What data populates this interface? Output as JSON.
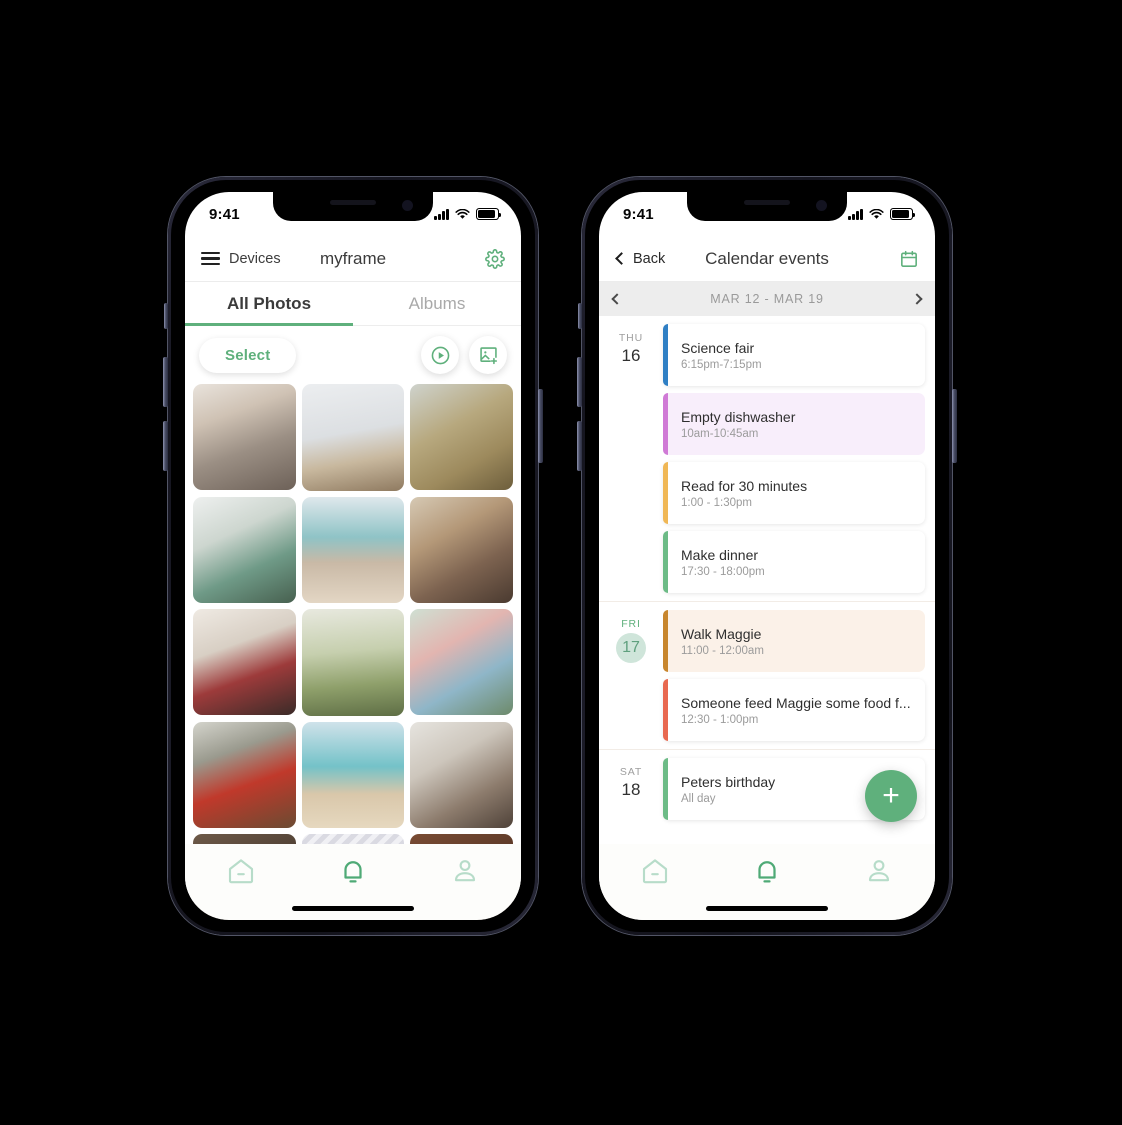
{
  "theme": {
    "accent_green": "#5fb07c",
    "accent_green_light": "#b7dcc9",
    "text_dark": "#3b3b3b",
    "text_muted": "#9a9a9a"
  },
  "phone_left": {
    "status_bar": {
      "time": "9:41",
      "signal_icon": "cellular-signal-icon",
      "wifi_icon": "wifi-icon",
      "battery_icon": "battery-icon"
    },
    "app_bar": {
      "menu_icon": "hamburger-menu-icon",
      "devices_label": "Devices",
      "title": "myframe",
      "settings_icon": "gear-icon"
    },
    "tabs": [
      {
        "label": "All Photos",
        "active": true
      },
      {
        "label": "Albums",
        "active": false
      }
    ],
    "actions": {
      "select_label": "Select",
      "play_icon": "play-circle-icon",
      "add_photo_icon": "add-image-icon"
    },
    "photos": [
      {
        "name": "grandparents-with-laptop"
      },
      {
        "name": "family-walking-in-snow"
      },
      {
        "name": "father-swinging-toddler"
      },
      {
        "name": "family-unpacking-boxes-living-room"
      },
      {
        "name": "mother-and-children-at-beach"
      },
      {
        "name": "family-of-three-on-couch"
      },
      {
        "name": "graduation-group-photo"
      },
      {
        "name": "family-on-park-path"
      },
      {
        "name": "family-with-bike-helmet-outdoors"
      },
      {
        "name": "father-teaching-child-to-ride-bike"
      },
      {
        "name": "couple-with-baby-on-beach"
      },
      {
        "name": "family-lying-together-smiling"
      },
      {
        "name": "partial-photo-bottom-left"
      },
      {
        "name": "partial-photo-bottom-center"
      },
      {
        "name": "partial-photo-bottom-right"
      }
    ],
    "bottom_nav": [
      {
        "icon": "home-icon",
        "active": false
      },
      {
        "icon": "bell-icon",
        "active": true
      },
      {
        "icon": "person-icon",
        "active": false
      }
    ]
  },
  "phone_right": {
    "status_bar": {
      "time": "9:41",
      "signal_icon": "cellular-signal-icon",
      "wifi_icon": "wifi-icon",
      "battery_icon": "battery-icon"
    },
    "app_bar": {
      "back_label": "Back",
      "back_icon": "chevron-left-icon",
      "title": "Calendar events",
      "calendar_icon": "calendar-icon"
    },
    "week_nav": {
      "prev_icon": "chevron-left-icon",
      "range_label": "MAR 12 - MAR 19",
      "next_icon": "chevron-right-icon"
    },
    "days": [
      {
        "dow": "THU",
        "date": "16",
        "highlighted": false,
        "events": [
          {
            "title": "Science fair",
            "time": "6:15pm-7:15pm",
            "bar_color": "#2f7fc4",
            "bg": "#ffffff"
          },
          {
            "title": "Empty dishwasher",
            "time": "10am-10:45am",
            "bar_color": "#d07ad6",
            "bg": "#f8eefb"
          },
          {
            "title": "Read for 30 minutes",
            "time": "1:00 - 1:30pm",
            "bar_color": "#f0b755",
            "bg": "#ffffff"
          },
          {
            "title": "Make dinner",
            "time": "17:30 - 18:00pm",
            "bar_color": "#6cbb86",
            "bg": "#ffffff"
          }
        ]
      },
      {
        "dow": "FRI",
        "date": "17",
        "highlighted": true,
        "events": [
          {
            "title": "Walk Maggie",
            "time": "11:00 - 12:00am",
            "bar_color": "#c8862d",
            "bg": "#fbf1e8"
          },
          {
            "title": "Someone feed Maggie some food f...",
            "time": "12:30 - 1:00pm",
            "bar_color": "#e8684f",
            "bg": "#ffffff"
          }
        ]
      },
      {
        "dow": "SAT",
        "date": "18",
        "highlighted": false,
        "events": [
          {
            "title": "Peters birthday",
            "time": "All day",
            "bar_color": "#6cbb86",
            "bg": "#ffffff"
          }
        ]
      }
    ],
    "fab": {
      "label": "+",
      "icon": "plus-icon"
    },
    "bottom_nav": [
      {
        "icon": "home-icon",
        "active": false
      },
      {
        "icon": "bell-icon",
        "active": true
      },
      {
        "icon": "person-icon",
        "active": false
      }
    ]
  }
}
